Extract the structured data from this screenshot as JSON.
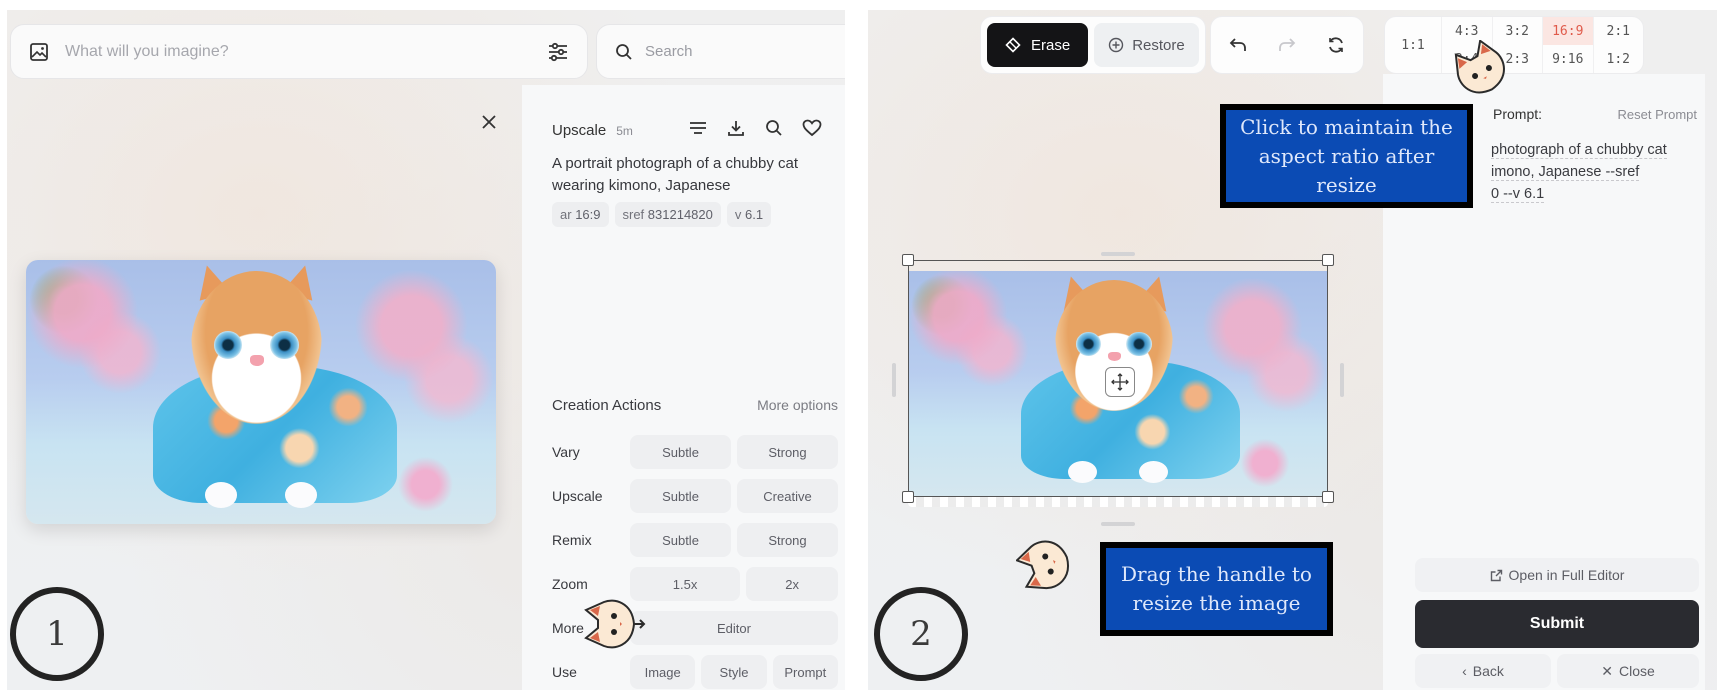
{
  "panel1": {
    "step_number": "1",
    "prompt_bar": {
      "placeholder": "What will you imagine?"
    },
    "search_bar": {
      "placeholder": "Search"
    },
    "image_alt": "Chubby cat wearing a blue floral kimono among cherry blossoms",
    "side": {
      "job_type": "Upscale",
      "time_ago": "5m",
      "description": "A portrait photograph of a chubby cat wearing kimono, Japanese",
      "tags": [
        {
          "key": "ar",
          "value": "16:9"
        },
        {
          "key": "sref",
          "value": "831214820"
        },
        {
          "key": "v",
          "value": "6.1"
        }
      ],
      "creation_actions_title": "Creation Actions",
      "more_options": "More options",
      "actions": [
        {
          "label": "Vary",
          "buttons": [
            "Subtle",
            "Strong"
          ]
        },
        {
          "label": "Upscale",
          "buttons": [
            "Subtle",
            "Creative"
          ]
        },
        {
          "label": "Remix",
          "buttons": [
            "Subtle",
            "Strong"
          ]
        },
        {
          "label": "Zoom",
          "buttons": [
            "1.5x",
            "2x"
          ]
        },
        {
          "label": "More",
          "buttons": [
            "Editor"
          ]
        },
        {
          "label": "Use",
          "buttons": [
            "Image",
            "Style",
            "Prompt"
          ]
        }
      ]
    }
  },
  "panel2": {
    "step_number": "2",
    "toolbar": {
      "erase_label": "Erase",
      "restore_label": "Restore"
    },
    "aspect_ratios": {
      "options": [
        "1:1",
        "4:3",
        "3:2",
        "16:9",
        "2:1",
        "3:4",
        "2:3",
        "9:16",
        "1:2"
      ],
      "selected": "16:9"
    },
    "prompt_label": "Prompt:",
    "reset_prompt": "Reset Prompt",
    "prompt_lines": [
      "photograph of a chubby cat",
      "imono, Japanese --sref",
      "0 --v 6.1"
    ],
    "open_full_editor": "Open in Full Editor",
    "submit": "Submit",
    "back": "Back",
    "close": "Close",
    "callouts": {
      "aspect": "Click to maintain the aspect ratio after resize",
      "resize": "Drag the handle to resize the image"
    }
  },
  "colors": {
    "erase_bg": "#141416",
    "selected_ratio_text": "#e05a4a",
    "selected_ratio_bg": "#fbe6e2",
    "callout_bg": "#0b4bb4",
    "submit_bg": "#2a2b30"
  }
}
